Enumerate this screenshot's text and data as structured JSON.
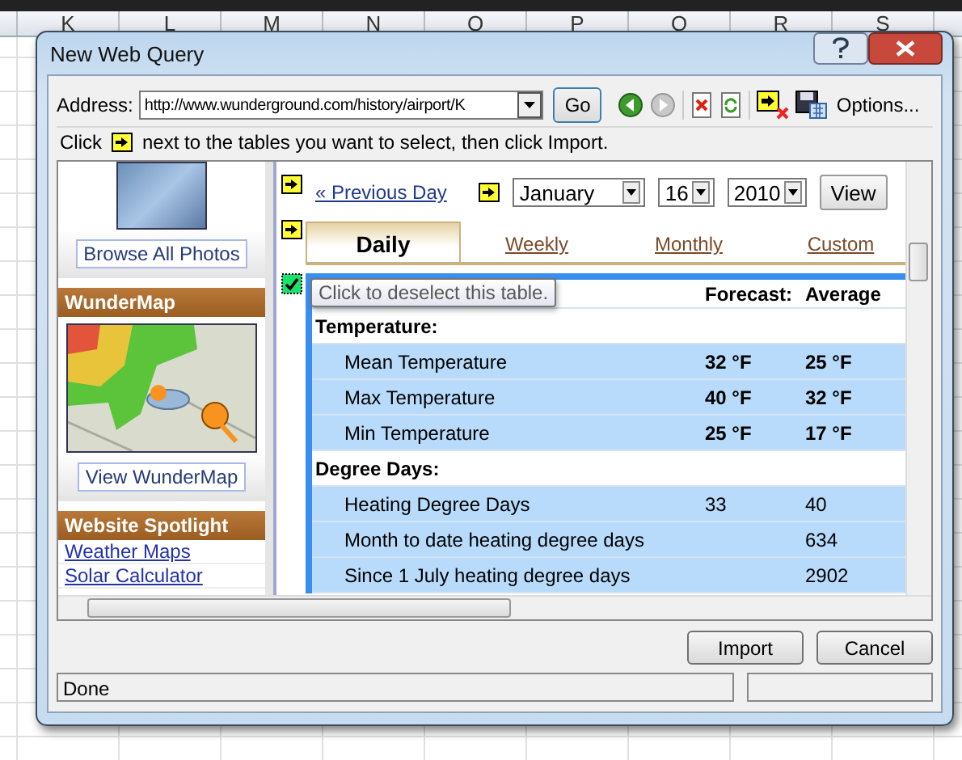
{
  "spreadsheet": {
    "column_headers": [
      "K",
      "L",
      "M",
      "N",
      "O",
      "P",
      "Q",
      "R",
      "S"
    ]
  },
  "dialog": {
    "title": "New Web Query"
  },
  "address": {
    "label": "Address:",
    "value": "http://www.wunderground.com/history/airport/K"
  },
  "go_button": "Go",
  "options_button": "Options...",
  "hint": {
    "lead": "Click",
    "rest": "next to the tables you want to select, then click Import."
  },
  "sidebar": {
    "browse_button": "Browse All Photos",
    "map_header": "WunderMap",
    "map_button": "View WunderMap",
    "spotlight_header": "Website Spotlight",
    "links": [
      "Weather Maps",
      "Solar Calculator"
    ]
  },
  "nav": {
    "previous_link": "« Previous Day",
    "month": "January",
    "day": "16",
    "year": "2010",
    "view_button": "View"
  },
  "tabs": [
    {
      "label": "Daily",
      "selected": true
    },
    {
      "label": "Weekly",
      "selected": false
    },
    {
      "label": "Monthly",
      "selected": false
    },
    {
      "label": "Custom",
      "selected": false
    }
  ],
  "table": {
    "selected": true,
    "tooltip": "Click to deselect this table.",
    "columns": [
      "Forecast:",
      "Average"
    ],
    "rows": [
      {
        "kind": "section",
        "label": "Temperature:"
      },
      {
        "kind": "value",
        "label": "Mean Temperature",
        "forecast": "32 °F",
        "average": "25 °F",
        "emphasis": true
      },
      {
        "kind": "value",
        "label": "Max Temperature",
        "forecast": "40 °F",
        "average": "32 °F",
        "emphasis": true
      },
      {
        "kind": "value",
        "label": "Min Temperature",
        "forecast": "25 °F",
        "average": "17 °F",
        "emphasis": true
      },
      {
        "kind": "section",
        "label": "Degree Days:"
      },
      {
        "kind": "value",
        "label": "Heating Degree Days",
        "forecast": "33",
        "average": "40",
        "emphasis": false
      },
      {
        "kind": "value",
        "label": "Month to date heating degree days",
        "average": "634",
        "emphasis": false
      },
      {
        "kind": "value",
        "label": "Since 1 July heating degree days",
        "average": "2902",
        "emphasis": false
      }
    ]
  },
  "buttons": [
    "Import",
    "Cancel"
  ],
  "status": {
    "text": "Done"
  }
}
